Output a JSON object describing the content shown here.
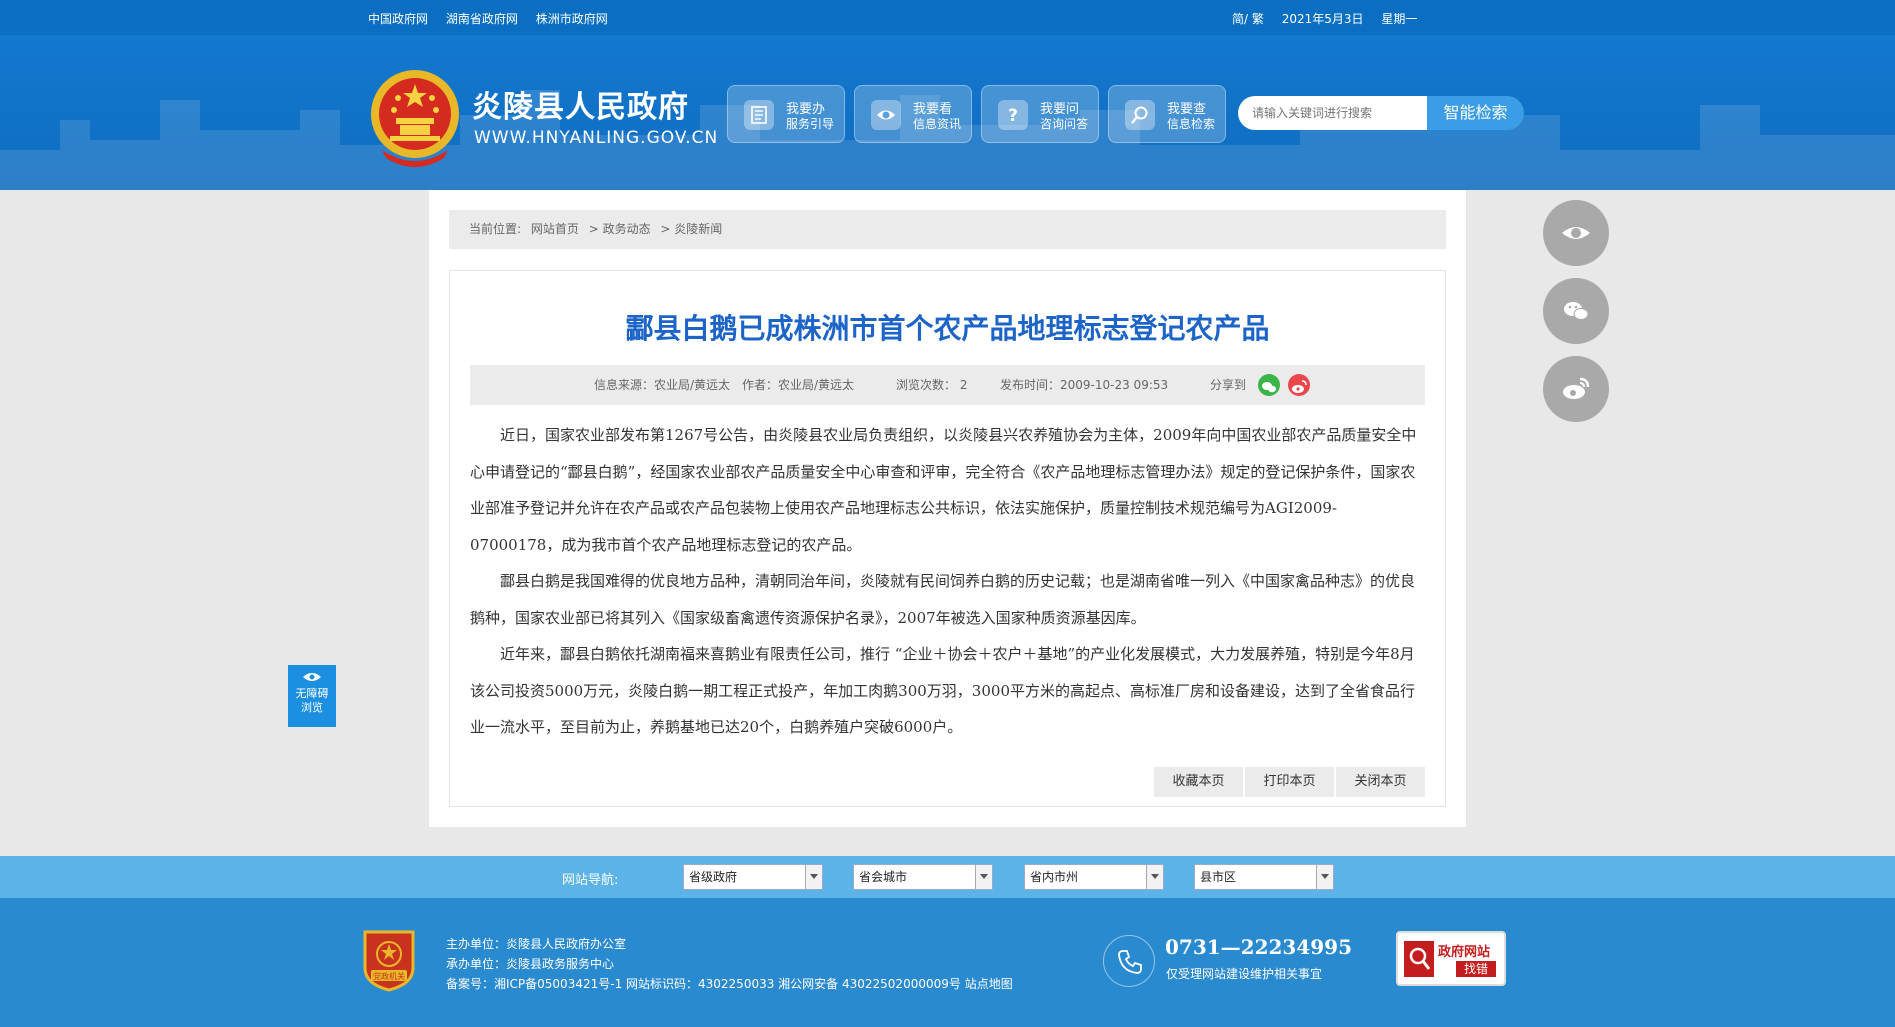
{
  "topbar": {
    "links": [
      "中国政府网",
      "湖南省政府网",
      "株洲市政府网"
    ],
    "lang": "简/ 繁",
    "date": "2021年5月3日",
    "weekday": "星期一"
  },
  "header": {
    "site_title": "炎陵县人民政府",
    "site_url": "WWW.HNYANLING.GOV.CN",
    "services": [
      {
        "line1": "我要办",
        "line2": "服务引导",
        "icon": "document-icon"
      },
      {
        "line1": "我要看",
        "line2": "信息资讯",
        "icon": "eye-icon"
      },
      {
        "line1": "我要问",
        "line2": "咨询问答",
        "icon": "question-icon"
      },
      {
        "line1": "我要查",
        "line2": "信息检索",
        "icon": "search-icon"
      }
    ],
    "search_placeholder": "请输入关键词进行搜索",
    "search_button": "智能检索"
  },
  "breadcrumb": {
    "label": "当前位置:",
    "items": [
      "网站首页",
      "> 政务动态",
      "> 炎陵新闻"
    ]
  },
  "article": {
    "title": "酃县白鹅已成株洲市首个农产品地理标志登记农产品",
    "meta": {
      "source": "信息来源：农业局/黄远太",
      "author": "作者：农业局/黄远太",
      "views": "浏览次数：  2",
      "published": "发布时间：2009-10-23 09:53",
      "share": "分享到"
    },
    "paragraphs": [
      "近日，国家农业部发布第1267号公告，由炎陵县农业局负责组织，以炎陵县兴农养殖协会为主体，2009年向中国农业部农产品质量安全中心申请登记的“酃县白鹅”，经国家农业部农产品质量安全中心审查和评审，完全符合《农产品地理标志管理办法》规定的登记保护条件，国家农业部准予登记并允许在农产品或农产品包装物上使用农产品地理标志公共标识，依法实施保护，质量控制技术规范编号为AGI2009-07000178，成为我市首个农产品地理标志登记的农产品。",
      "酃县白鹅是我国难得的优良地方品种，清朝同治年间，炎陵就有民间饲养白鹅的历史记载；也是湖南省唯一列入《中国家禽品种志》的优良鹅种，国家农业部已将其列入《国家级畜禽遗传资源保护名录》，2007年被选入国家种质资源基因库。",
      "近年来，酃县白鹅依托湖南福来喜鹅业有限责任公司，推行 “企业＋协会＋农户＋基地”的产业化发展模式，大力发展养殖，特别是今年8月该公司投资5000万元，炎陵白鹅一期工程正式投产，年加工肉鹅300万羽，3000平方米的高起点、高标准厂房和设备建设，达到了全省食品行业一流水平，至目前为止，养鹅基地已达20个，白鹅养殖户突破6000户。"
    ],
    "actions": [
      "收藏本页",
      "打印本页",
      "关闭本页"
    ]
  },
  "accessibility": {
    "line1": "无障碍",
    "line2": "浏览"
  },
  "nav": {
    "label": "网站导航:",
    "selects": [
      "省级政府",
      "省会城市",
      "省内市州",
      "县市区"
    ]
  },
  "footer": {
    "badge_text": "党政机关",
    "host": "主办单位：炎陵县人民政府办公室",
    "operator": "承办单位：炎陵县政务服务中心",
    "record": "备案号：湘ICP备05003421号-1 网站标识码：4302250033 湘公网安备 43022502000009号 站点地图",
    "phone": "0731—22234995",
    "phone_note": "仅受理网站建设维护相关事宜",
    "jiucuo_line1": "政府网站",
    "jiucuo_line2": "找错"
  },
  "colors": {
    "primary_blue": "#0a6fc2",
    "title_blue": "#1d64c8",
    "nav_blue": "#5bb3e8",
    "footer_blue": "#2a8ad0"
  }
}
